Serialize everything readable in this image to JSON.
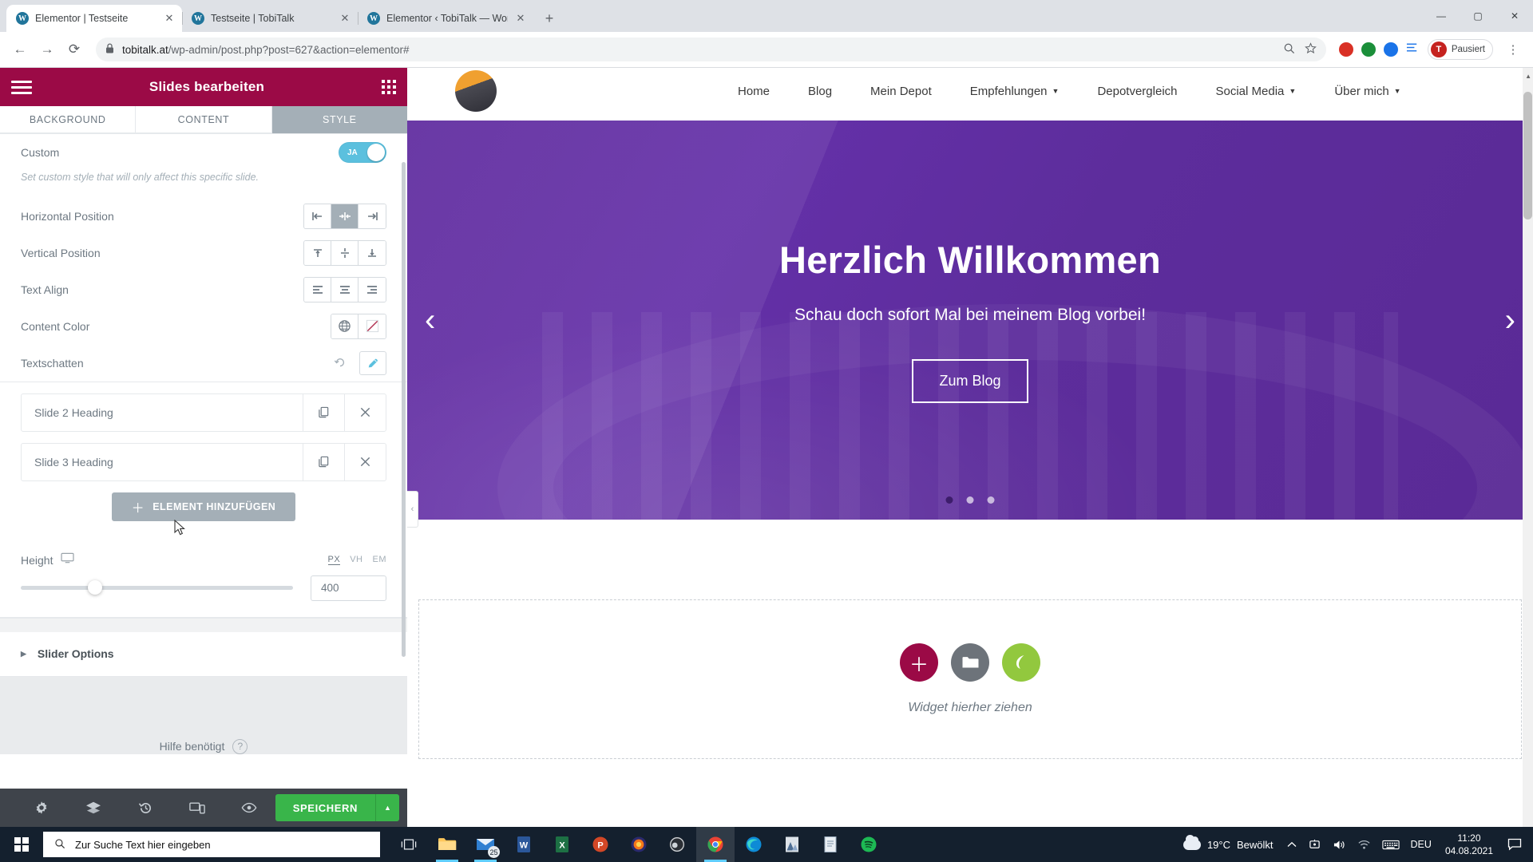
{
  "browser": {
    "tabs": [
      {
        "title": "Elementor | Testseite",
        "icon": "wordpress-icon",
        "active": true
      },
      {
        "title": "Testseite | TobiTalk",
        "icon": "wordpress-icon",
        "active": false
      },
      {
        "title": "Elementor ‹ TobiTalk — WordPre",
        "icon": "wordpress-icon",
        "active": false
      }
    ],
    "new_tab_label": "+",
    "window_controls": {
      "minimize": "—",
      "maximize": "▢",
      "close": "✕"
    },
    "nav": {
      "back": "←",
      "forward": "→",
      "reload": "⟳"
    },
    "url": {
      "host": "tobitalk.at",
      "path": "/wp-admin/post.php?post=627&action=elementor#"
    },
    "lock_icon": "lock-icon",
    "omnibox_icons": [
      "zoom-icon",
      "bookmark-star-icon"
    ],
    "extensions": [
      "extension-red-icon",
      "extension-green-icon",
      "extension-blue-icon",
      "extension-list-icon"
    ],
    "profile": {
      "initial": "T",
      "label": "Pausiert"
    },
    "menu_icon": "kebab-menu-icon"
  },
  "panel": {
    "title": "Slides bearbeiten",
    "menu_icon": "hamburger-icon",
    "apps_icon": "grid-apps-icon",
    "tabs": [
      {
        "label": "BACKGROUND",
        "active": false
      },
      {
        "label": "CONTENT",
        "active": false
      },
      {
        "label": "STYLE",
        "active": true
      }
    ],
    "controls": {
      "custom_label": "Custom",
      "custom_toggle_state": "on",
      "custom_toggle_text": "JA",
      "custom_desc": "Set custom style that will only affect this specific slide.",
      "horizontal_position_label": "Horizontal Position",
      "horizontal_position_options": [
        "left",
        "center",
        "right"
      ],
      "horizontal_position_selected": 1,
      "vertical_position_label": "Vertical Position",
      "vertical_position_options": [
        "top",
        "middle",
        "bottom"
      ],
      "vertical_position_selected": -1,
      "text_align_label": "Text Align",
      "text_align_options": [
        "left",
        "center",
        "right"
      ],
      "text_align_selected": -1,
      "content_color_label": "Content Color",
      "content_color_icons": [
        "globe-icon",
        "no-color-icon"
      ],
      "textshadow_label": "Textschatten",
      "textshadow_icons": [
        "reset-icon",
        "edit-pencil-icon"
      ]
    },
    "repeater": [
      {
        "title": "Slide 2 Heading",
        "duplicate_icon": "duplicate-icon",
        "remove_icon": "close-icon"
      },
      {
        "title": "Slide 3 Heading",
        "duplicate_icon": "duplicate-icon",
        "remove_icon": "close-icon"
      }
    ],
    "add_item_label": "ELEMENT HINZUFÜGEN",
    "add_item_icon": "plus-icon",
    "height": {
      "label": "Height",
      "device_icon": "desktop-icon",
      "units": [
        {
          "label": "PX",
          "active": true
        },
        {
          "label": "VH",
          "active": false
        },
        {
          "label": "EM",
          "active": false
        }
      ],
      "value": "400",
      "slider_percent": 24.5
    },
    "accordion": {
      "label": "Slider Options",
      "icon": "triangle-right-icon"
    },
    "help": {
      "label": "Hilfe benötigt",
      "icon": "question-mark-icon"
    },
    "footer": {
      "icons": [
        "settings-gear-icon",
        "layers-icon",
        "history-icon",
        "responsive-mode-icon",
        "preview-eye-icon"
      ],
      "save_label": "SPEICHERN",
      "save_arrow_icon": "chevron-up-icon"
    },
    "collapse_icon": "chevron-left-icon"
  },
  "site": {
    "logo": "site-avatar-logo",
    "nav_items": [
      {
        "label": "Home",
        "has_caret": false
      },
      {
        "label": "Blog",
        "has_caret": false
      },
      {
        "label": "Mein Depot",
        "has_caret": false
      },
      {
        "label": "Empfehlungen",
        "has_caret": true
      },
      {
        "label": "Depotvergleich",
        "has_caret": false
      },
      {
        "label": "Social Media",
        "has_caret": true
      },
      {
        "label": "Über mich",
        "has_caret": true
      }
    ],
    "slider": {
      "heading": "Herzlich Willkommen",
      "subheading": "Schau doch sofort Mal bei meinem Blog vorbei!",
      "button_label": "Zum Blog",
      "prev_icon": "chevron-left-icon",
      "next_icon": "chevron-right-icon",
      "dots": 3,
      "active_dot": 0,
      "background_color": "#5d2d9c"
    },
    "dropzone": {
      "text": "Widget hierher ziehen",
      "buttons": [
        {
          "name": "add-widget-button",
          "icon": "plus-icon",
          "color": "#9b0a46"
        },
        {
          "name": "template-library-button",
          "icon": "folder-icon",
          "color": "#6d737a"
        },
        {
          "name": "elementor-leaf-button",
          "icon": "leaf-icon",
          "color": "#92c83e"
        }
      ]
    }
  },
  "taskbar": {
    "start_icon": "windows-start-icon",
    "search_placeholder": "Zur Suche Text hier eingeben",
    "search_icon": "search-icon",
    "task_view_icon": "task-view-icon",
    "apps": [
      {
        "name": "file-explorer-icon"
      },
      {
        "name": "mail-icon",
        "badge": "25"
      },
      {
        "name": "word-icon"
      },
      {
        "name": "excel-icon"
      },
      {
        "name": "powerpoint-icon"
      },
      {
        "name": "firefox-icon"
      },
      {
        "name": "obs-icon"
      },
      {
        "name": "chrome-icon",
        "active": true
      },
      {
        "name": "edge-icon"
      },
      {
        "name": "photos-icon"
      },
      {
        "name": "notepad-icon"
      },
      {
        "name": "spotify-icon"
      }
    ],
    "tray": {
      "weather_temp": "19°C",
      "weather_desc": "Bewölkt",
      "weather_icon": "cloud-icon",
      "chevron_icon": "chevron-up-icon",
      "icons": [
        "onedrive-icon",
        "volume-icon",
        "network-icon",
        "keyboard-icon"
      ],
      "language": "DEU",
      "time": "11:20",
      "date": "04.08.2021",
      "action_center_icon": "action-center-icon"
    }
  }
}
